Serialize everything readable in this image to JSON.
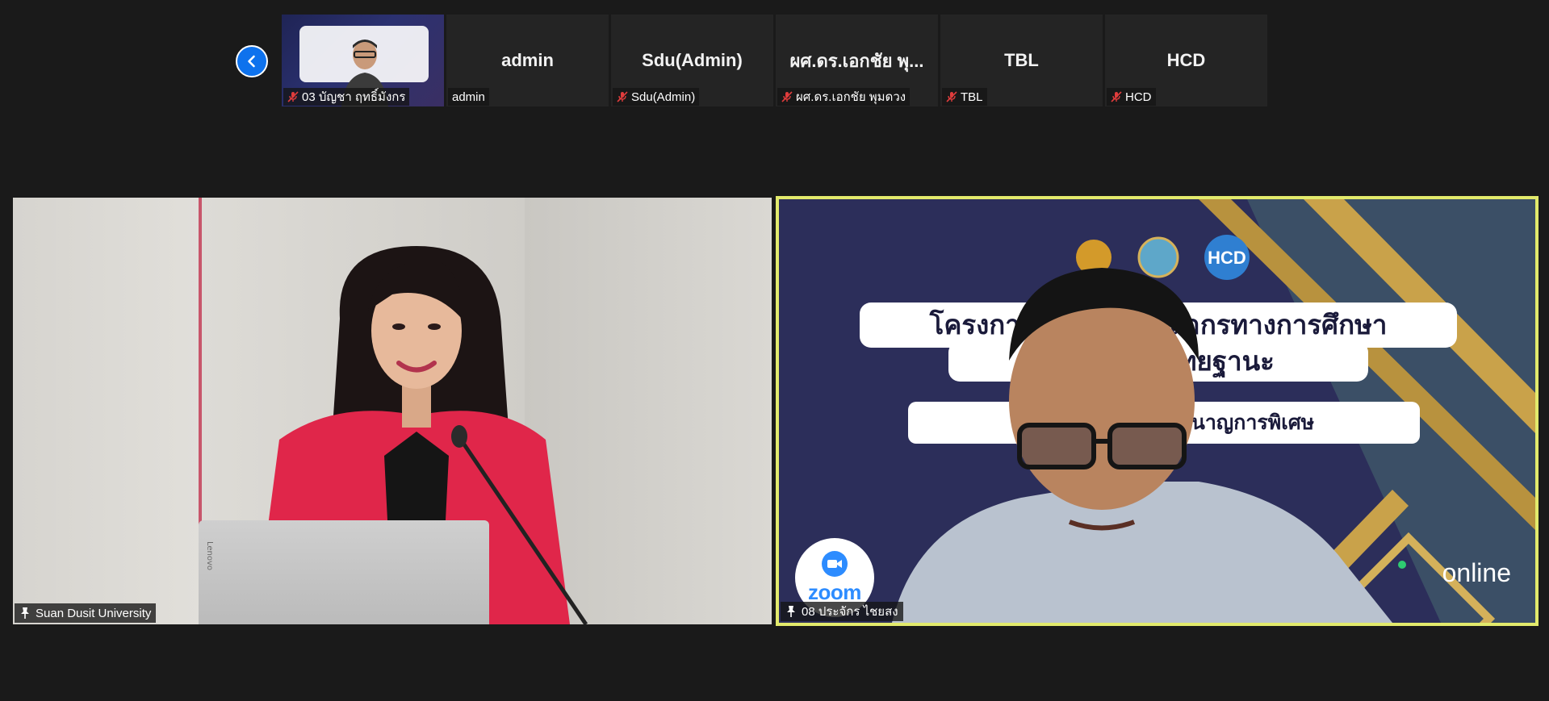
{
  "filmstrip": {
    "tiles": [
      {
        "big_name": "",
        "label": "03 บัญชา ฤทธิ์มังกร",
        "muted": true,
        "has_video": true
      },
      {
        "big_name": "admin",
        "label": "admin",
        "muted": false,
        "has_video": false
      },
      {
        "big_name": "Sdu(Admin)",
        "label": "Sdu(Admin)",
        "muted": true,
        "has_video": false
      },
      {
        "big_name": "ผศ.ดร.เอกชัย  พุ...",
        "label": "ผศ.ดร.เอกชัย  พุมดวง",
        "muted": true,
        "has_video": false
      },
      {
        "big_name": "TBL",
        "label": "TBL",
        "muted": true,
        "has_video": false
      },
      {
        "big_name": "HCD",
        "label": "HCD",
        "muted": true,
        "has_video": false
      }
    ]
  },
  "main": {
    "left_label": "Suan Dusit University",
    "right_label": "08 ประจักร ไชยสง",
    "laptop_brand": "Lenovo",
    "slide": {
      "line1": "โครงการพัฒน                   ละบุคลากรทางการศึกษา",
      "line2": "ก่อน                   นเป็นวิทยฐานะ",
      "line3": "หลักสูตรผู้                   ทยการชำนาญการพิเศษ",
      "badge_text": "zoom",
      "online_text": "online",
      "logo_text": "HCD"
    }
  },
  "colors": {
    "background": "#1a1a1a",
    "tile_bg": "#242424",
    "active_speaker_border": "#e2ea6c",
    "accent_blue": "#0e72ed",
    "muted_red": "#e03c3c",
    "zoom_blue": "#2d8cff"
  },
  "icons": {
    "prev": "chevron-left-icon",
    "muted": "mic-muted-icon",
    "pin": "pin-icon",
    "camera": "video-camera-icon"
  }
}
